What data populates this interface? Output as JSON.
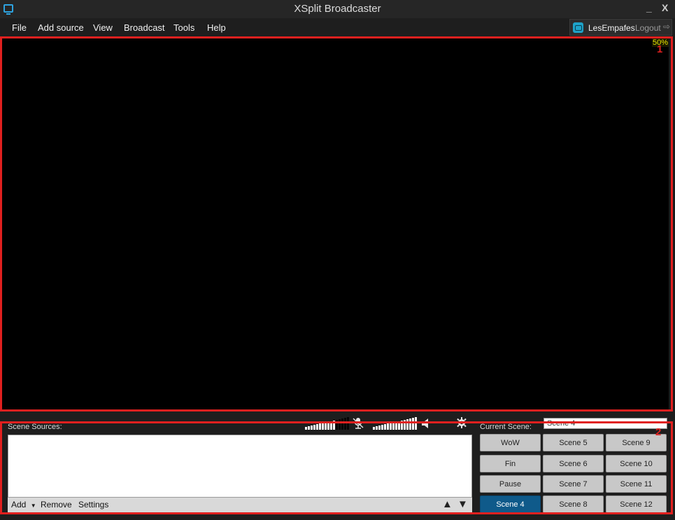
{
  "window": {
    "title": "XSplit Broadcaster",
    "minimize": "_",
    "close": "X"
  },
  "menu": {
    "items": [
      "File",
      "Add source",
      "View",
      "Broadcast",
      "Tools",
      "Help"
    ]
  },
  "user": {
    "name": "LesEmpafes",
    "logout": "Logout",
    "logout_icon": "⇨"
  },
  "preview": {
    "zoom": "50%"
  },
  "annotations": {
    "label_1": "1",
    "label_2": "2",
    "color": "#e0201f"
  },
  "audio": {
    "mic_level": 0.7,
    "speaker_level": 1.0,
    "mic_icon": "mic-muted-icon",
    "speaker_icon": "speaker-icon",
    "settings_icon": "gear-icon"
  },
  "sources": {
    "label": "Scene Sources:",
    "add": "Add",
    "remove": "Remove",
    "settings": "Settings"
  },
  "scenes": {
    "label": "Current Scene:",
    "current": "Scene 4",
    "input_value": "Scene 4",
    "active_color": "#0f5a8a",
    "buttons": [
      [
        "WoW",
        "Scene 5",
        "Scene 9"
      ],
      [
        "Fin",
        "Scene 6",
        "Scene 10"
      ],
      [
        "Pause",
        "Scene 7",
        "Scene 11"
      ],
      [
        "Scene 4",
        "Scene 8",
        "Scene 12"
      ]
    ]
  }
}
